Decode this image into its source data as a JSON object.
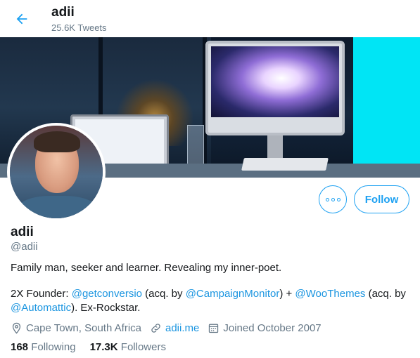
{
  "header": {
    "name": "adii",
    "tweet_count": "25.6K Tweets"
  },
  "profile": {
    "name": "adii",
    "handle": "@adii",
    "bio_line1": "Family man, seeker and learner. Revealing my inner-poet.",
    "bio_line2": {
      "prefix": "2X Founder: ",
      "mention1": "@getconversio",
      "text1": " (acq. by ",
      "mention2": "@CampaignMonitor",
      "text2": ") + ",
      "mention3": "@WooThemes",
      "text3": " (acq. by ",
      "mention4": "@Automattic",
      "text4": "). Ex-Rockstar."
    },
    "location": "Cape Town, South Africa",
    "website": "adii.me",
    "joined": "Joined October 2007",
    "following_count": "168",
    "following_label": "Following",
    "followers_count": "17.3K",
    "followers_label": "Followers"
  },
  "actions": {
    "follow_label": "Follow"
  },
  "icons": {
    "back": "arrow-left-icon",
    "more": "more-horizontal-icon",
    "location": "location-pin-icon",
    "link": "link-icon",
    "calendar": "calendar-icon"
  },
  "colors": {
    "accent": "#1da1f2",
    "link": "#1b95e0",
    "secondary_text": "#657786",
    "primary_text": "#14171a"
  }
}
